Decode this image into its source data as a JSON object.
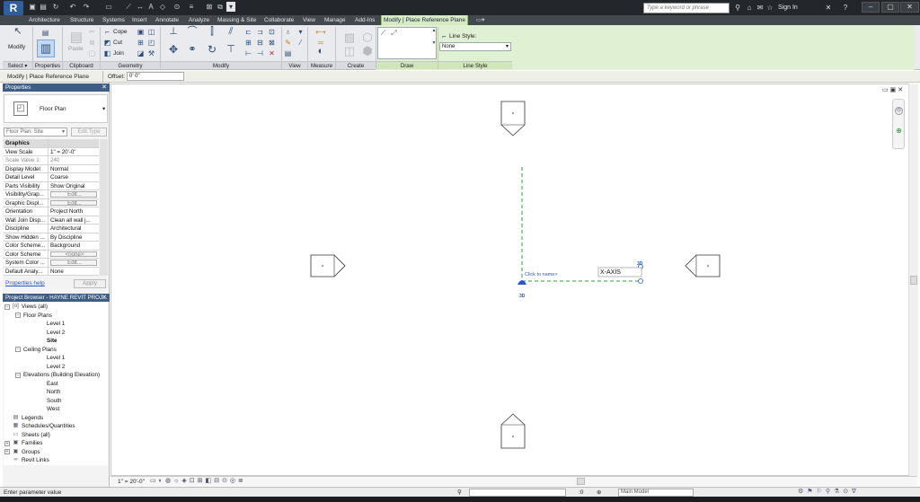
{
  "title_bar": {
    "app_button": "R",
    "search_placeholder": "Type a keyword or phrase",
    "sign_in": "Sign In",
    "help": "?"
  },
  "tabs": [
    "Architecture",
    "Structure",
    "Systems",
    "Insert",
    "Annotate",
    "Analyze",
    "Massing & Site",
    "Collaborate",
    "View",
    "Manage",
    "Add-Ins",
    "Modify | Place Reference Plane"
  ],
  "ribbon": {
    "modify_label": "Modify",
    "select_label": "Select ▾",
    "properties_label": "Properties",
    "clipboard_label": "Clipboard",
    "paste_label": "Paste",
    "geometry_label": "Geometry",
    "cope_label": "Cope",
    "cut_label": "Cut",
    "join_label": "Join",
    "modify_panel_label": "Modify",
    "view_label": "View",
    "measure_label": "Measure",
    "create_label": "Create",
    "draw_label": "Draw",
    "line_style_panel_label": "Line Style",
    "line_style_caption": "Line Style:",
    "line_style_value": "None"
  },
  "options_bar": {
    "context": "Modify | Place Reference Plane",
    "offset_label": "Offset:",
    "offset_value": "0'  0\""
  },
  "properties": {
    "header": "Properties",
    "type_name": "Floor Plan",
    "instance_select": "Floor Plan: Site",
    "edit_type": "Edit Type",
    "rows": [
      {
        "k": "Graphics",
        "v": "",
        "group": true
      },
      {
        "k": "View Scale",
        "v": "1\" = 20'-0\""
      },
      {
        "k": "Scale Value    1:",
        "v": "240",
        "dim": true
      },
      {
        "k": "Display Model",
        "v": "Normal"
      },
      {
        "k": "Detail Level",
        "v": "Coarse"
      },
      {
        "k": "Parts Visibility",
        "v": "Show Original"
      },
      {
        "k": "Visibility/Grap...",
        "v": "Edit...",
        "btn": true
      },
      {
        "k": "Graphic Displ...",
        "v": "Edit...",
        "btn": true
      },
      {
        "k": "Orientation",
        "v": "Project North"
      },
      {
        "k": "Wall Join Disp...",
        "v": "Clean all wall j..."
      },
      {
        "k": "Discipline",
        "v": "Architectural"
      },
      {
        "k": "Show Hidden ...",
        "v": "By Discipline"
      },
      {
        "k": "Color Scheme...",
        "v": "Background"
      },
      {
        "k": "Color Scheme",
        "v": "<none>",
        "btn": true
      },
      {
        "k": "System Color ...",
        "v": "Edit...",
        "btn": true
      },
      {
        "k": "Default Analy...",
        "v": "None"
      }
    ],
    "help_link": "Properties help",
    "apply": "Apply"
  },
  "browser": {
    "header": "Project Browser - HAYNE REVIT PROJ...",
    "nodes": [
      {
        "label": "Views (all)",
        "indent": 0,
        "tw": "−",
        "icon": "[o]"
      },
      {
        "label": "Floor Plans",
        "indent": 1,
        "tw": "−"
      },
      {
        "label": "Level 1",
        "indent": 2
      },
      {
        "label": "Level 2",
        "indent": 2
      },
      {
        "label": "Site",
        "indent": 2,
        "bold": true
      },
      {
        "label": "Ceiling Plans",
        "indent": 1,
        "tw": "−"
      },
      {
        "label": "Level 1",
        "indent": 2
      },
      {
        "label": "Level 2",
        "indent": 2
      },
      {
        "label": "Elevations (Building Elevation)",
        "indent": 1,
        "tw": "−"
      },
      {
        "label": "East",
        "indent": 2
      },
      {
        "label": "North",
        "indent": 2
      },
      {
        "label": "South",
        "indent": 2
      },
      {
        "label": "West",
        "indent": 2
      },
      {
        "label": "Legends",
        "indent": 0,
        "icon": "▤"
      },
      {
        "label": "Schedules/Quantities",
        "indent": 0,
        "icon": "▦"
      },
      {
        "label": "Sheets (all)",
        "indent": 0,
        "icon": "▭"
      },
      {
        "label": "Families",
        "indent": 0,
        "tw": "+",
        "icon": "▣"
      },
      {
        "label": "Groups",
        "indent": 0,
        "tw": "+",
        "icon": "▣"
      },
      {
        "label": "Revit Links",
        "indent": 0,
        "icon": "∞"
      }
    ]
  },
  "canvas": {
    "click_to_name": "Click to name>",
    "xaxis_label": "X-AXIS",
    "tag_3d_a": "3D",
    "tag_3d_b": "3D"
  },
  "view_control": {
    "scale": "1\" = 20'-0\""
  },
  "status": {
    "message": "Enter parameter value",
    "model": "Main Model",
    "count": ":0"
  },
  "colors": {
    "ribbon_context": "#e0f0d2",
    "pane_header": "#3f5e85",
    "ref_plane": "#2e9e3e",
    "selection_blue": "#2a57c8"
  }
}
